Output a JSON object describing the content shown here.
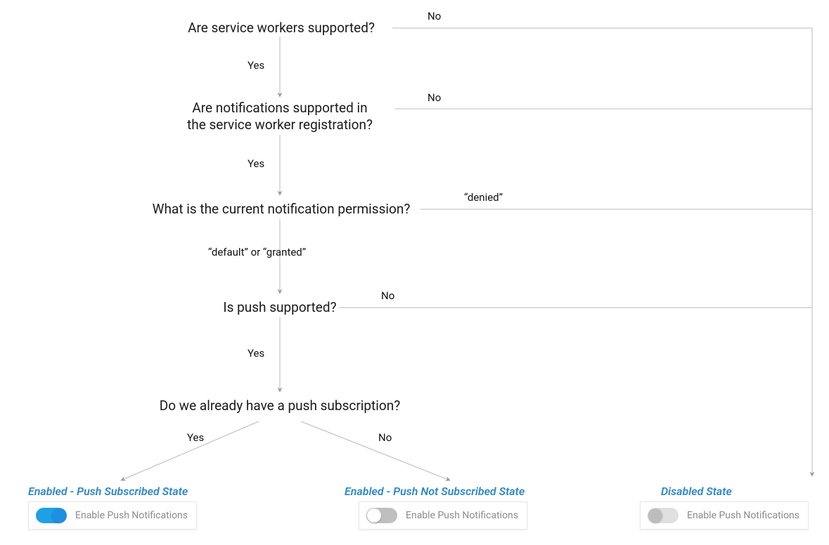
{
  "nodes": {
    "q1": "Are service workers supported?",
    "q2_l1": "Are notifications supported in",
    "q2_l2": "the service worker registration?",
    "q3": "What is the current notification permission?",
    "q4": "Is push supported?",
    "q5": "Do we already have a push subscription?"
  },
  "edges": {
    "q1_no": "No",
    "q1_yes": "Yes",
    "q2_no": "No",
    "q2_yes": "Yes",
    "q3_denied": "“denied”",
    "q3_default_granted": "“default” or “granted”",
    "q4_no": "No",
    "q4_yes": "Yes",
    "q5_yes": "Yes",
    "q5_no": "No"
  },
  "states": {
    "subscribed": {
      "title": "Enabled - Push Subscribed State",
      "label": "Enable Push Notifications",
      "toggle": "on"
    },
    "not_subscribed": {
      "title": "Enabled - Push Not Subscribed State",
      "label": "Enable Push Notifications",
      "toggle": "off"
    },
    "disabled": {
      "title": "Disabled State",
      "label": "Enable Push Notifications",
      "toggle": "disabled"
    }
  },
  "chart_data": {
    "type": "flowchart",
    "nodes": [
      {
        "id": "q1",
        "text": "Are service workers supported?"
      },
      {
        "id": "q2",
        "text": "Are notifications supported in the service worker registration?"
      },
      {
        "id": "q3",
        "text": "What is the current notification permission?"
      },
      {
        "id": "q4",
        "text": "Is push supported?"
      },
      {
        "id": "q5",
        "text": "Do we already have a push subscription?"
      },
      {
        "id": "s_sub",
        "text": "Enabled - Push Subscribed State"
      },
      {
        "id": "s_nosub",
        "text": "Enabled - Push Not Subscribed State"
      },
      {
        "id": "s_dis",
        "text": "Disabled State"
      }
    ],
    "edges": [
      {
        "from": "q1",
        "to": "q2",
        "label": "Yes"
      },
      {
        "from": "q1",
        "to": "s_dis",
        "label": "No"
      },
      {
        "from": "q2",
        "to": "q3",
        "label": "Yes"
      },
      {
        "from": "q2",
        "to": "s_dis",
        "label": "No"
      },
      {
        "from": "q3",
        "to": "q4",
        "label": "“default” or “granted”"
      },
      {
        "from": "q3",
        "to": "s_dis",
        "label": "“denied”"
      },
      {
        "from": "q4",
        "to": "q5",
        "label": "Yes"
      },
      {
        "from": "q4",
        "to": "s_dis",
        "label": "No"
      },
      {
        "from": "q5",
        "to": "s_sub",
        "label": "Yes"
      },
      {
        "from": "q5",
        "to": "s_nosub",
        "label": "No"
      }
    ]
  }
}
